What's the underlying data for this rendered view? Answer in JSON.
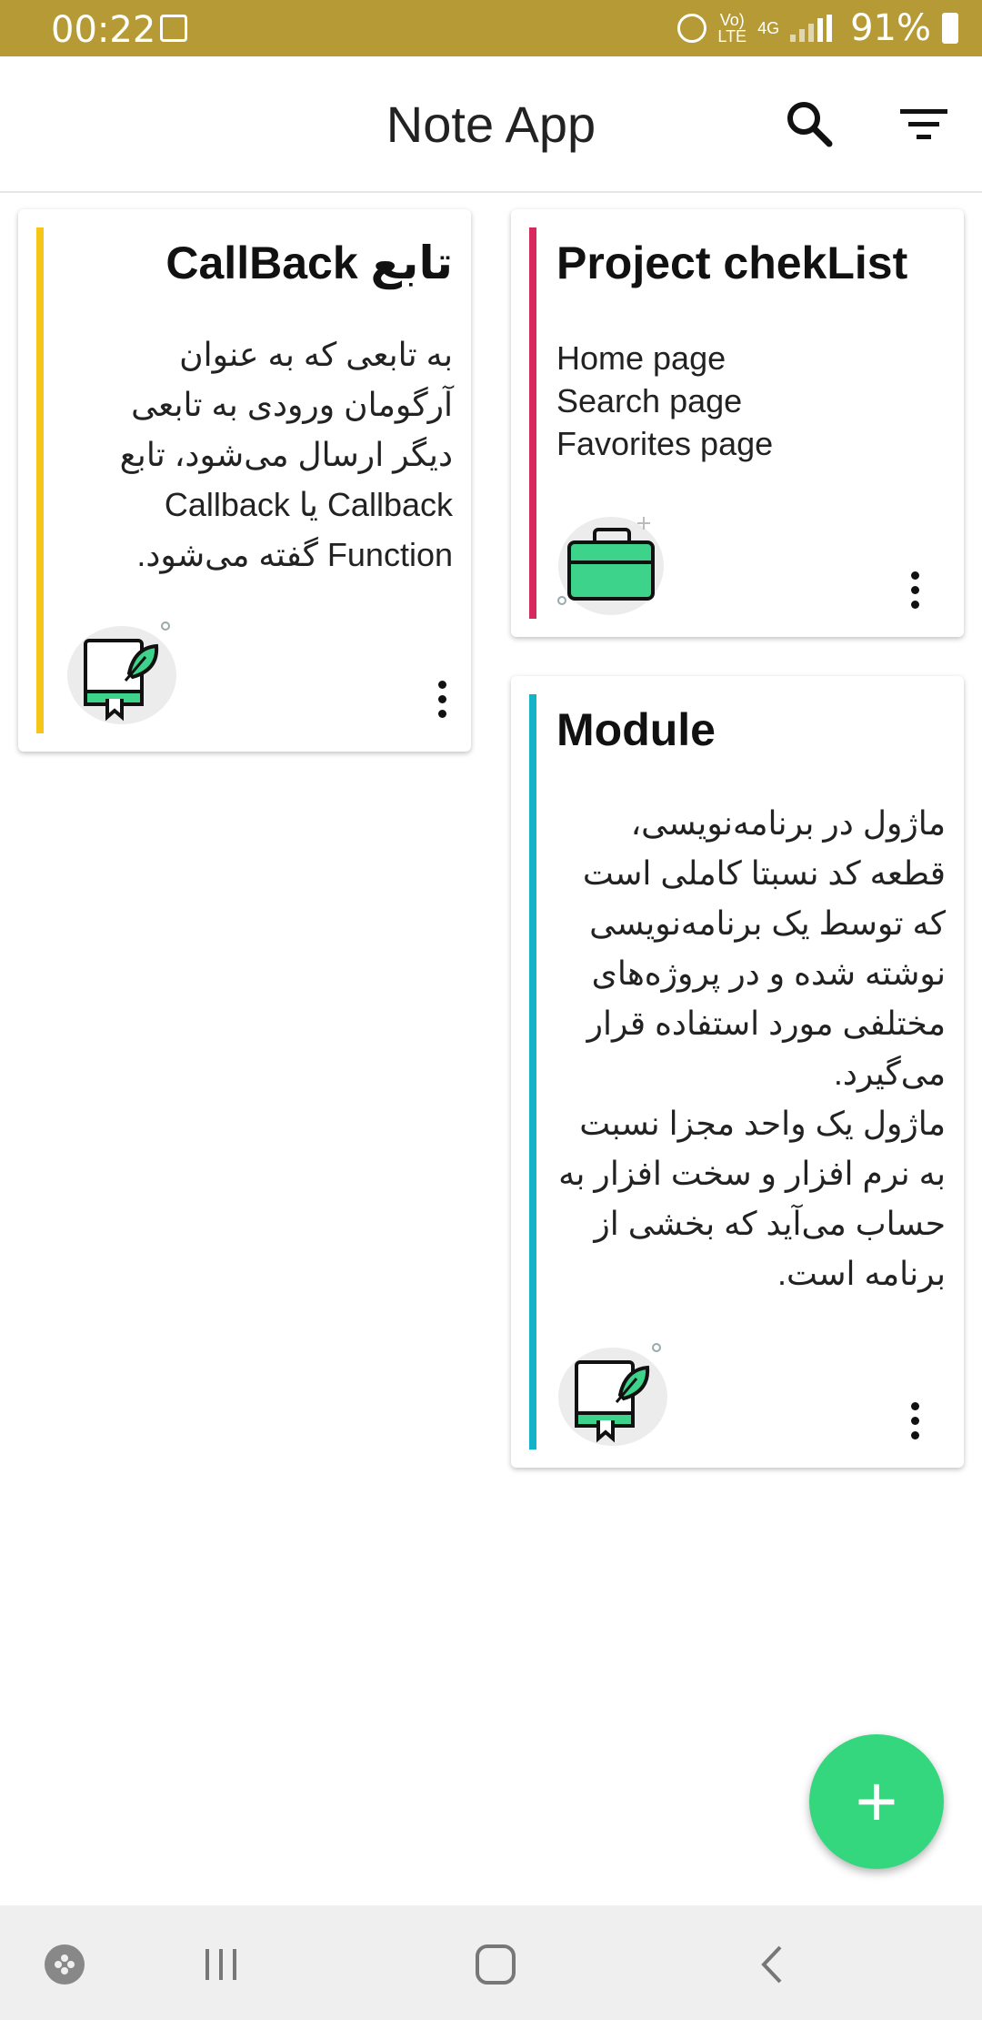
{
  "status_bar": {
    "time": "00:22",
    "network_label_top": "Vo)",
    "network_label_bottom": "LTE",
    "network_type": "4G",
    "battery": "91%"
  },
  "app_bar": {
    "title": "Note App",
    "search_icon": "search-icon",
    "filter_icon": "filter-icon"
  },
  "notes": [
    {
      "title": "تابع CallBack",
      "body": "به تابعی که به عنوان آرگومان ورودی به تابعی دیگر ارسال می‌شود، تابع Callback یا Callback Function گفته می‌شود.",
      "accent_color": "#f5c518",
      "icon": "book-leaf-icon",
      "direction": "rtl"
    },
    {
      "title": "Project chekList",
      "body": "Home page\nSearch page\n Favorites page",
      "accent_color": "#d62a5e",
      "icon": "briefcase-icon",
      "direction": "ltr"
    },
    {
      "title": "Module",
      "body": "ماژول در برنامه‌نویسی، قطعه کد نسبتا کاملی است که توسط یک برنامه‌نویسی نوشته شده و در پروژه‌های مختلفی مورد استفاده قرار می‌گیرد.\nماژول یک واحد مجزا نسبت به نرم افزار و سخت افزار به حساب می‌آید که بخشی از برنامه است.",
      "accent_color": "#14b3c9",
      "icon": "book-leaf-icon",
      "direction": "rtl"
    }
  ],
  "fab": {
    "label": "+"
  },
  "nav_bar": {
    "items": [
      "game-launcher-icon",
      "recents-icon",
      "home-icon",
      "back-icon"
    ]
  }
}
